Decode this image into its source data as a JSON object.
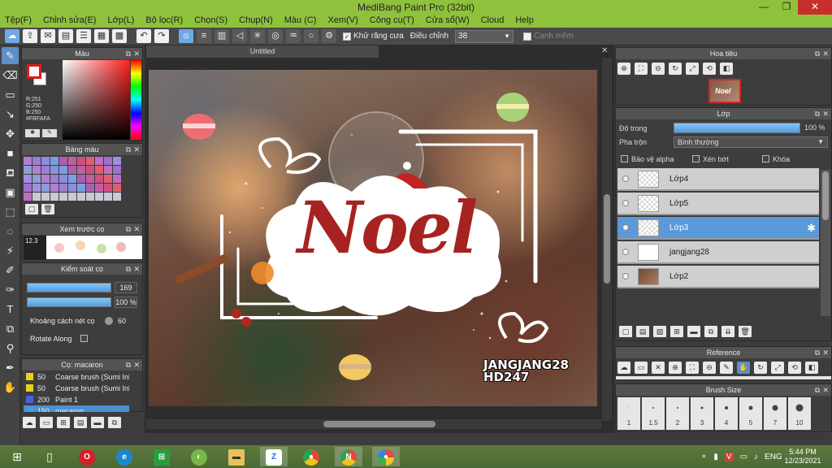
{
  "window": {
    "title": "MediBang Paint Pro (32bit)",
    "minimize": "—",
    "restore": "❐",
    "close": "✕"
  },
  "menu": [
    "Tệp(F)",
    "Chỉnh sửa(E)",
    "Lớp(L)",
    "Bộ lọc(R)",
    "Chọn(S)",
    "Chụp(N)",
    "Màu (C)",
    "Xem(V)",
    "Công cụ(T)",
    "Cửa sổ(W)",
    "Cloud",
    "Help"
  ],
  "toolbar": {
    "antialias_label": "Khử răng cưa",
    "correction_label": "Điều chỉnh",
    "correction_value": "38",
    "snap_label": "Cạnh mềm"
  },
  "color_panel": {
    "title": "Màu",
    "r": "R:251",
    "g": "G:250",
    "b": "B:250",
    "hex": "#FBFAFA",
    "fg_color": "#fbfafa"
  },
  "palette_panel": {
    "title": "Bảng màu"
  },
  "brush_preview": {
    "title": "Xem trước cọ",
    "size": "12.3"
  },
  "brush_control": {
    "title": "Kiểm soát cọ",
    "size_value": "169",
    "opacity_value": "100 %",
    "spacing_label": "Khoảng cách nét cọ",
    "spacing_value": "60",
    "rotate_label": "Rotate Along"
  },
  "brush_list": {
    "title": "Cọ: macaron",
    "items": [
      {
        "size": "50",
        "name": "Coarse brush (Sumi Ink)",
        "color": "#e8d020"
      },
      {
        "size": "50",
        "name": "Coarse brush (Sumi Ink)",
        "color": "#e8d020"
      },
      {
        "size": "200",
        "name": "Paint 1",
        "color": "#4a5fe0"
      },
      {
        "size": "150",
        "name": "macaron",
        "color": "#4a9be0"
      }
    ]
  },
  "canvas": {
    "tab_title": "Untitled",
    "artwork_text": "Noel",
    "watermark_line1": "JANGJANG28",
    "watermark_line2": "HD247"
  },
  "navigator": {
    "title": "Hoa tiêu",
    "thumb_text": "Noel"
  },
  "layer_panel": {
    "title": "Lớp",
    "opacity_label": "Độ trong",
    "opacity_value": "100 %",
    "opacity_level": 1.0,
    "blend_label": "Pha trộn",
    "blend_value": "Bình thường",
    "protect_alpha": "Bảo vệ alpha",
    "clipping": "Xén bớt",
    "lock": "Khóa",
    "layers": [
      {
        "name": "Lớp4",
        "selected": false
      },
      {
        "name": "Lớp5",
        "selected": false
      },
      {
        "name": "Lớp3",
        "selected": true
      },
      {
        "name": "jangjang28",
        "selected": false
      },
      {
        "name": "Lớp2",
        "selected": false
      }
    ]
  },
  "reference_panel": {
    "title": "Reference"
  },
  "brush_size_panel": {
    "title": "Brush Size",
    "sizes": [
      "1",
      "1.5",
      "2",
      "3",
      "4",
      "5",
      "7",
      "10"
    ]
  },
  "taskbar": {
    "time": "5:44 PM",
    "date": "12/23/2021",
    "lang": "ENG"
  }
}
